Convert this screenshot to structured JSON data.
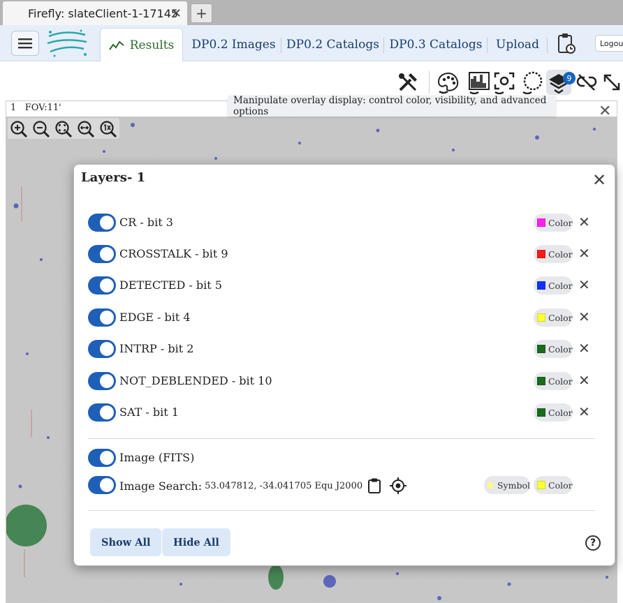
{
  "browser": {
    "tab_title": "Firefly: slateClient-1-17145",
    "close_glyph": "✕",
    "new_tab_glyph": "+"
  },
  "app": {
    "tabs": [
      {
        "label": "Results",
        "active": true
      },
      {
        "label": "DP0.2 Images"
      },
      {
        "label": "DP0.2 Catalogs"
      },
      {
        "label": "DP0.3 Catalogs"
      },
      {
        "label": "Upload"
      }
    ],
    "logout_label": "Logou"
  },
  "toolbar": {
    "layers_count": "9",
    "tooltip": "Manipulate overlay display: control color, visibility, and advanced options",
    "icons": [
      "tools-icon",
      "color-palette-icon",
      "stretch-histogram-icon",
      "select-region-icon",
      "lasso-icon",
      "layers-icon",
      "unlink-icon",
      "expand-icon"
    ]
  },
  "viewer": {
    "plot_index": "1",
    "fov": "FOV:11'",
    "close_glyph": "✕"
  },
  "layers": {
    "title": "Layers- 1",
    "close_glyph": "✕",
    "color_label": "Color",
    "remove_glyph": "✕",
    "mask_rows": [
      {
        "label": "CR - bit 3",
        "color": "#ff22ee"
      },
      {
        "label": "CROSSTALK - bit 9",
        "color": "#ff1a1a"
      },
      {
        "label": "DETECTED - bit 5",
        "color": "#1133ff"
      },
      {
        "label": "EDGE - bit 4",
        "color": "#ffff33"
      },
      {
        "label": "INTRP - bit 2",
        "color": "#1a6b1a"
      },
      {
        "label": "NOT_DEBLENDED - bit 10",
        "color": "#1a6b1a"
      },
      {
        "label": "SAT - bit 1",
        "color": "#1a6b1a"
      }
    ],
    "image_row": {
      "label": "Image (FITS)"
    },
    "search_row": {
      "label": "Image Search:",
      "coords": "53.047812, -34.041705 Equ J2000",
      "symbol_label": "Symbol",
      "symbol_color": "#ffff66",
      "color": "#ffff33"
    },
    "show_all_label": "Show All",
    "hide_all_label": "Hide All",
    "help_glyph": "?"
  }
}
